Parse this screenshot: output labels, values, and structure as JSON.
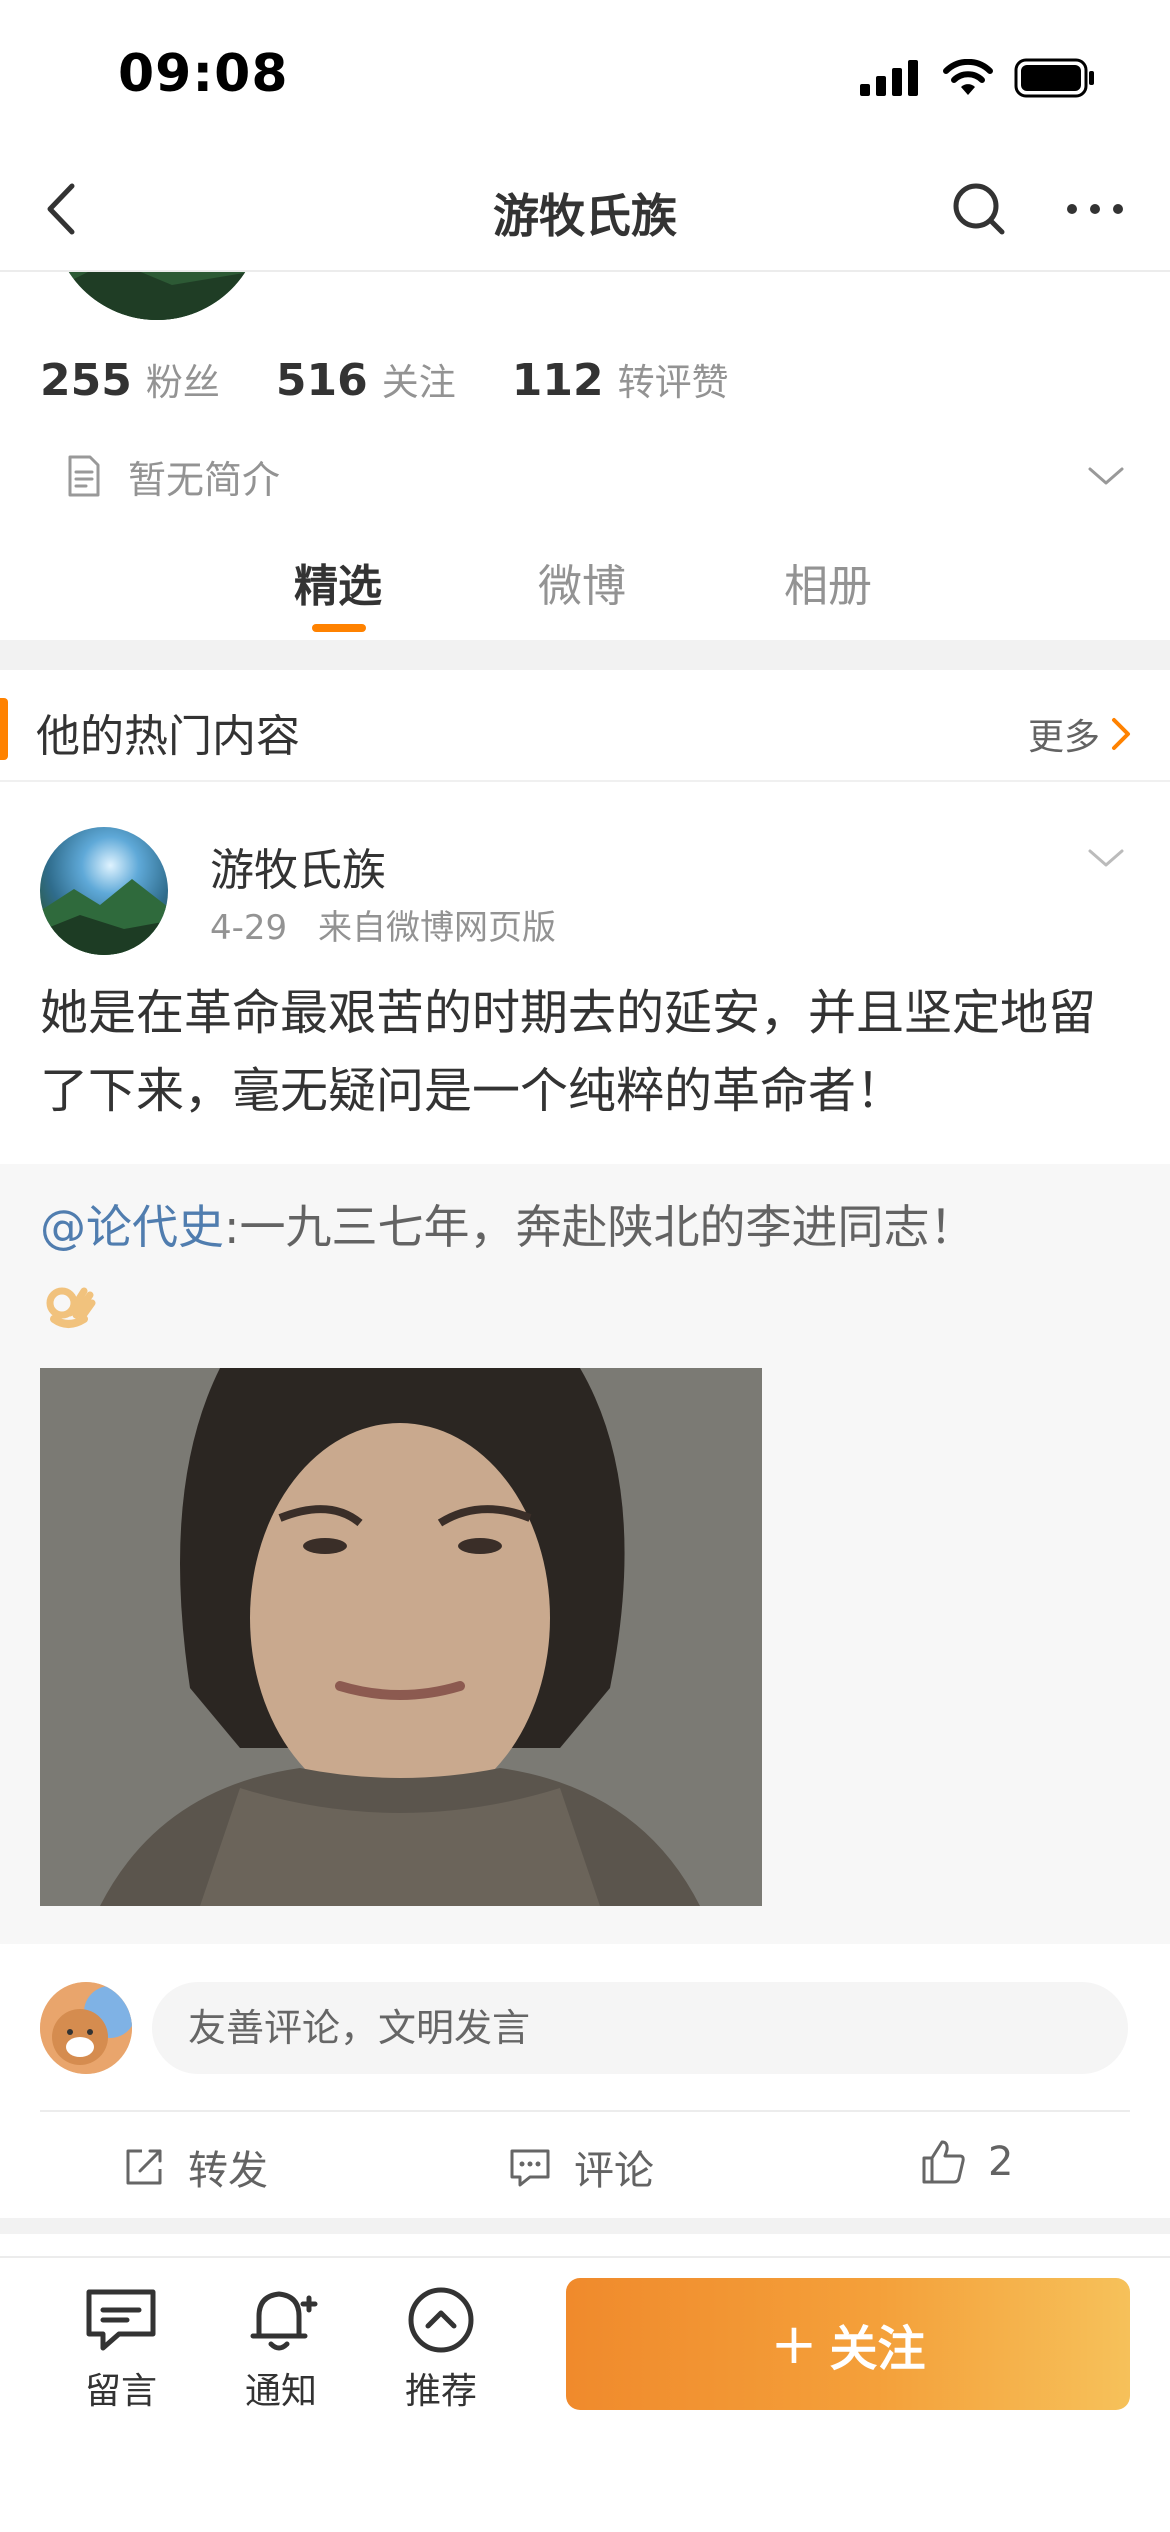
{
  "status_bar": {
    "time": "09:08"
  },
  "nav": {
    "title": "游牧氏族"
  },
  "profile": {
    "stats": [
      {
        "num": "255",
        "label": "粉丝"
      },
      {
        "num": "516",
        "label": "关注"
      },
      {
        "num": "112",
        "label": "转评赞"
      }
    ],
    "bio": "暂无简介"
  },
  "tabs": [
    "精选",
    "微博",
    "相册"
  ],
  "section": {
    "title": "他的热门内容",
    "more": "更多"
  },
  "post": {
    "author": "游牧氏族",
    "date": "4-29",
    "source": "来自微博网页版",
    "text": "她是在革命最艰苦的时期去的延安，并且坚定地留了下来，毫无疑问是一个纯粹的革命者！",
    "repost": {
      "mention": "@论代史",
      "text": ":一九三七年，奔赴陕北的李进同志！"
    }
  },
  "comment": {
    "placeholder": "友善评论，文明发言"
  },
  "actions": {
    "repost": "转发",
    "comment": "评论",
    "like_count": "2"
  },
  "bottom_bar": {
    "items": [
      "留言",
      "通知",
      "推荐"
    ],
    "follow": "关注"
  },
  "colors": {
    "accent": "#ff8200",
    "link": "#507daf"
  }
}
